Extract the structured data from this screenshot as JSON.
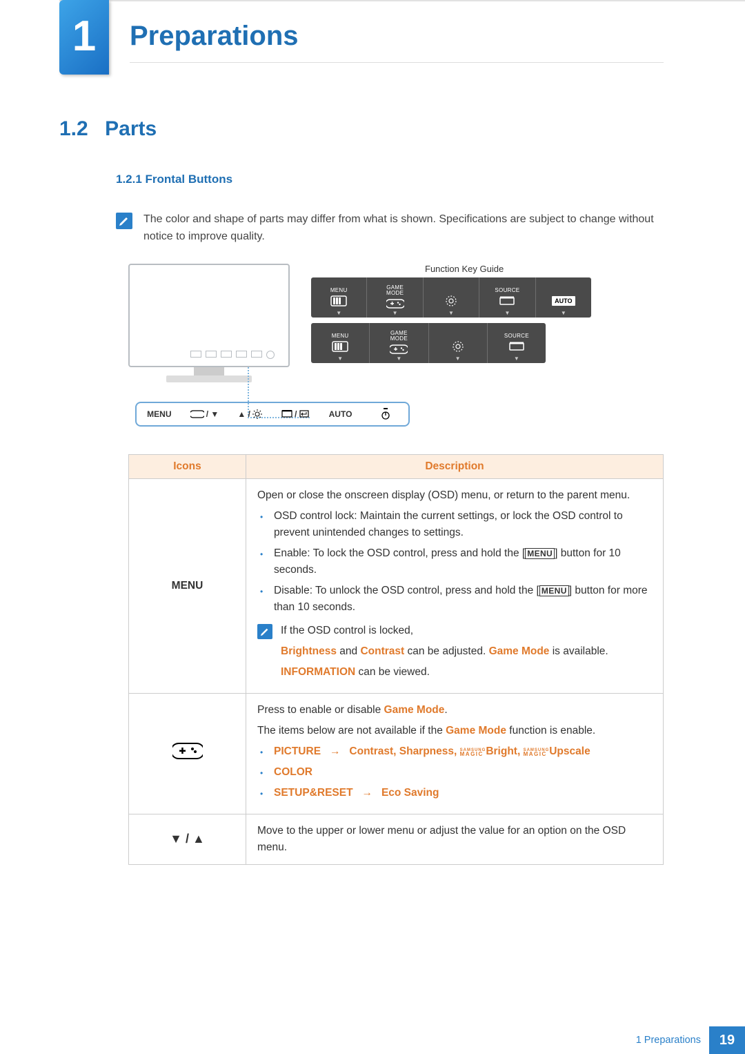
{
  "chapter": {
    "number": "1",
    "title": "Preparations"
  },
  "section": {
    "number": "1.2",
    "title": "Parts"
  },
  "subsection": "1.2.1  Frontal Buttons",
  "note_text": "The color and shape of parts may differ from what is shown. Specifications are subject to change without notice to improve quality.",
  "diagram": {
    "guide_label": "Function Key Guide",
    "osd_cols": {
      "menu": "MENU",
      "game_top": "GAME",
      "game_bot": "MODE",
      "source": "SOURCE",
      "auto": "AUTO"
    },
    "strip": {
      "menu": "MENU",
      "auto": "AUTO"
    }
  },
  "table": {
    "head_icons": "Icons",
    "head_desc": "Description",
    "row_menu": {
      "icon": "MENU",
      "intro": "Open or close the onscreen display (OSD) menu, or return to the parent menu.",
      "b1a": "OSD control lock: Maintain the current settings, or lock the OSD control to prevent unintended changes to settings.",
      "b2a": "Enable: To lock the OSD control, press and hold the [",
      "b2b": "] button for 10 seconds.",
      "b3a": "Disable: To unlock the OSD control, press and hold the [",
      "b3b": "] button for more than 10 seconds.",
      "mini1": "If the OSD control is locked,",
      "mini2a": "Brightness",
      "mini2b": " and ",
      "mini2c": "Contrast",
      "mini2d": " can be adjusted. ",
      "mini2e": "Game Mode",
      "mini2f": " is available.",
      "mini3a": "INFORMATION",
      "mini3b": " can be viewed."
    },
    "row_game": {
      "line1a": "Press to enable or disable ",
      "line1b": "Game Mode",
      "line1c": ".",
      "line2a": "The items below are not available if the ",
      "line2b": "Game Mode",
      "line2c": " function is enable.",
      "b1": {
        "picture": "PICTURE",
        "arrow": "→",
        "list": "Contrast, Sharpness, ",
        "bright": "Bright, ",
        "upscale": "Upscale"
      },
      "b2": "COLOR",
      "b3a": "SETUP&RESET",
      "b3arrow": "→",
      "b3b": "Eco Saving"
    },
    "row_arrows": {
      "desc": "Move to the upper or lower menu or adjust the value for an option on the OSD menu."
    }
  },
  "footer": {
    "label": "1 Preparations",
    "page": "19"
  }
}
